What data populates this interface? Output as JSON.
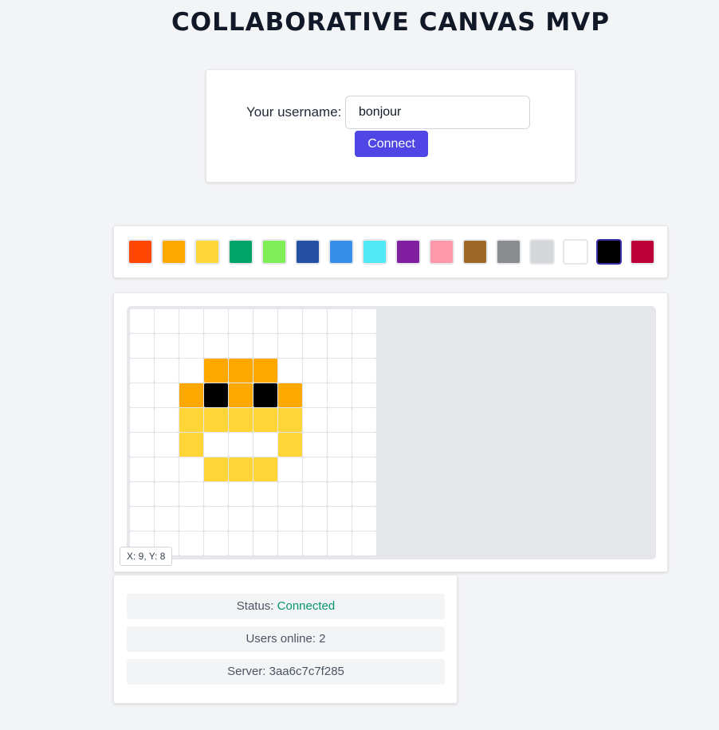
{
  "page": {
    "title": "COLLABORATIVE CANVAS MVP"
  },
  "login": {
    "label": "Your username:",
    "username_value": "bonjour",
    "connect_label": "Connect"
  },
  "palette": {
    "colors": [
      "#ff4500",
      "#ffa800",
      "#ffd635",
      "#00a368",
      "#7eed56",
      "#2450a4",
      "#3690ea",
      "#51e9f4",
      "#811e9f",
      "#ff99aa",
      "#9c6926",
      "#898d90",
      "#d4d7d9",
      "#ffffff",
      "#000000",
      "#be0039"
    ],
    "selected_index": 14
  },
  "canvas": {
    "grid_size": 10,
    "background": "#ffffff",
    "pixels": [
      {
        "x": 3,
        "y": 2,
        "color": "#ffa800"
      },
      {
        "x": 4,
        "y": 2,
        "color": "#ffa800"
      },
      {
        "x": 5,
        "y": 2,
        "color": "#ffa800"
      },
      {
        "x": 2,
        "y": 3,
        "color": "#ffa800"
      },
      {
        "x": 3,
        "y": 3,
        "color": "#000000"
      },
      {
        "x": 4,
        "y": 3,
        "color": "#ffa800"
      },
      {
        "x": 5,
        "y": 3,
        "color": "#000000"
      },
      {
        "x": 6,
        "y": 3,
        "color": "#ffa800"
      },
      {
        "x": 2,
        "y": 4,
        "color": "#ffd635"
      },
      {
        "x": 3,
        "y": 4,
        "color": "#ffd635"
      },
      {
        "x": 4,
        "y": 4,
        "color": "#ffd635"
      },
      {
        "x": 5,
        "y": 4,
        "color": "#ffd635"
      },
      {
        "x": 6,
        "y": 4,
        "color": "#ffd635"
      },
      {
        "x": 2,
        "y": 5,
        "color": "#ffd635"
      },
      {
        "x": 6,
        "y": 5,
        "color": "#ffd635"
      },
      {
        "x": 3,
        "y": 6,
        "color": "#ffd635"
      },
      {
        "x": 4,
        "y": 6,
        "color": "#ffd635"
      },
      {
        "x": 5,
        "y": 6,
        "color": "#ffd635"
      }
    ],
    "coords_text": "X: 9, Y: 8"
  },
  "status": {
    "status_prefix": "Status: ",
    "status_value": "Connected",
    "status_color": "#059669",
    "users_online": "Users online: 2",
    "server": "Server: 3aa6c7c7f285"
  }
}
